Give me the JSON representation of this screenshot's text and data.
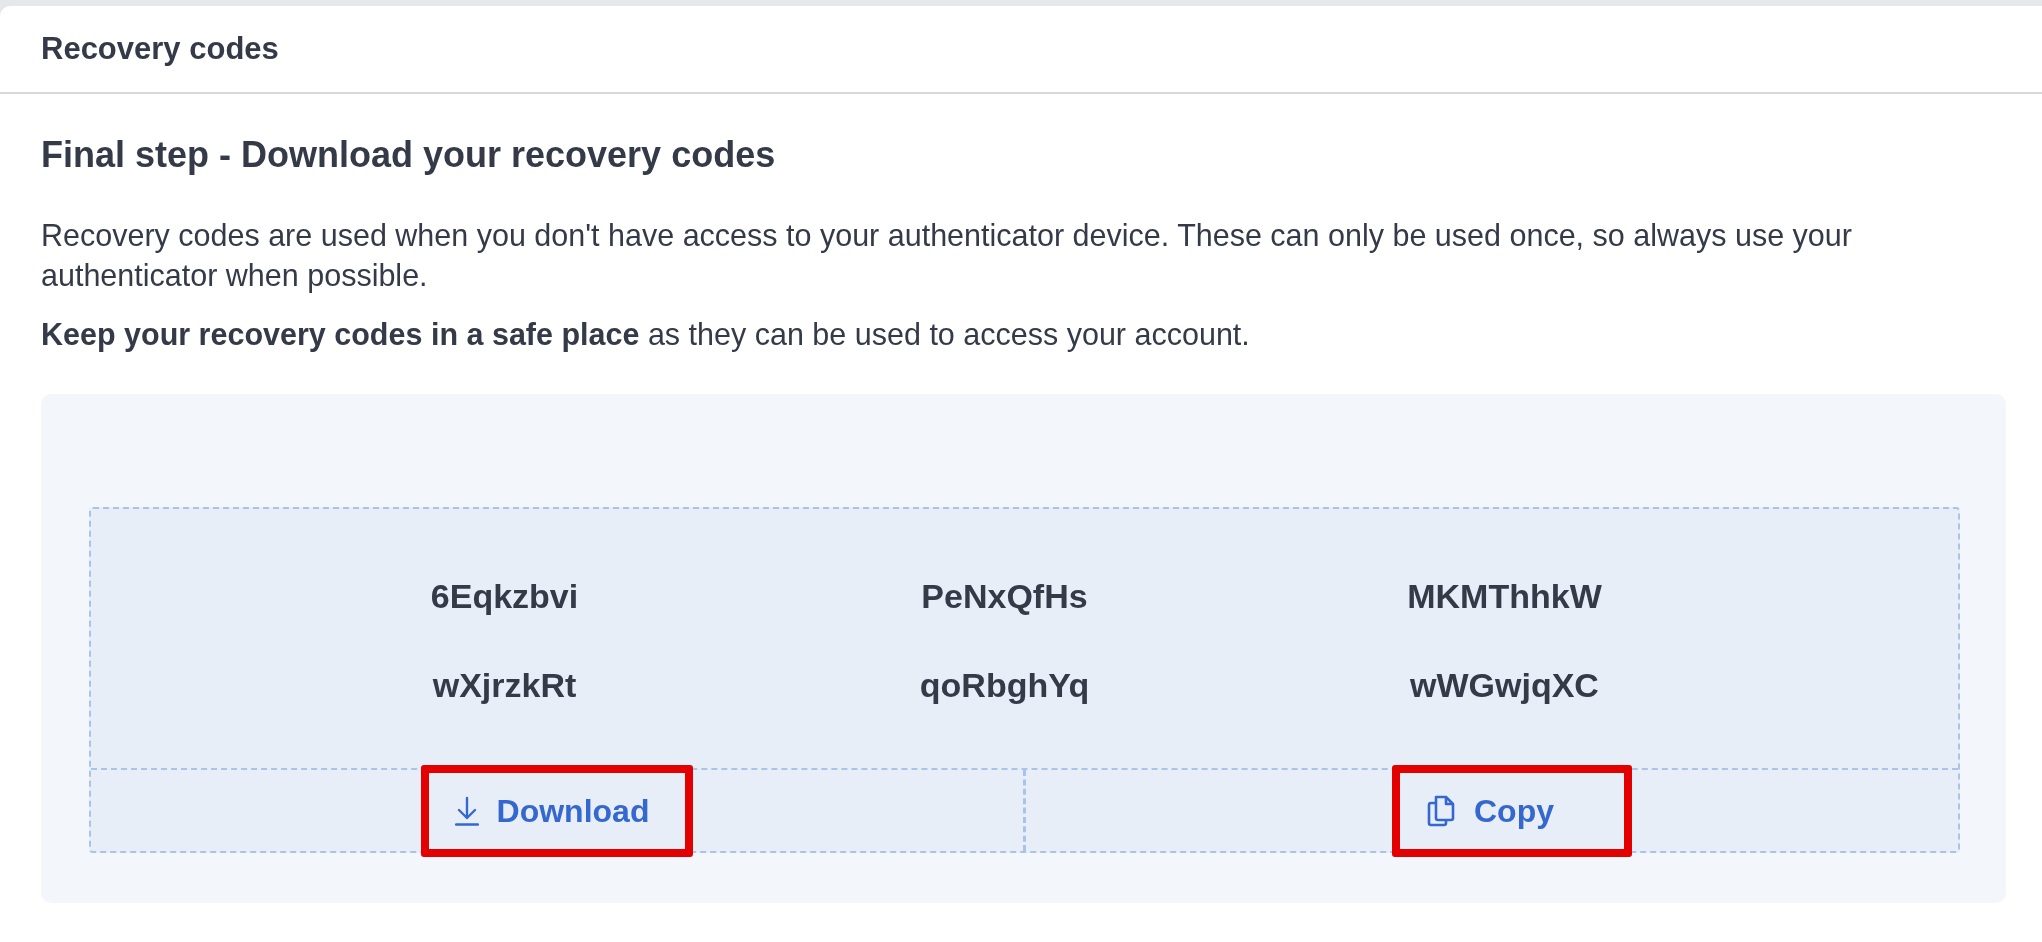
{
  "panel": {
    "title": "Recovery codes"
  },
  "heading": "Final step - Download your recovery codes",
  "paragraphs": [
    "Recovery codes are used when you don't have access to your authenticator device. These can only be used once, so always use your authenticator when possible.",
    "**Keep your recovery codes in a safe place** as they can be used to access your account."
  ],
  "codes": [
    "6Eqkzbvi",
    "PeNxQfHs",
    "MKMThhkW",
    "wXjrzkRt",
    "qoRbghYq",
    "wWGwjqXC"
  ],
  "actions": [
    {
      "kind": "download",
      "label": "Download",
      "highlighted": true
    },
    {
      "kind": "copy",
      "label": "Copy",
      "highlighted": true
    }
  ]
}
